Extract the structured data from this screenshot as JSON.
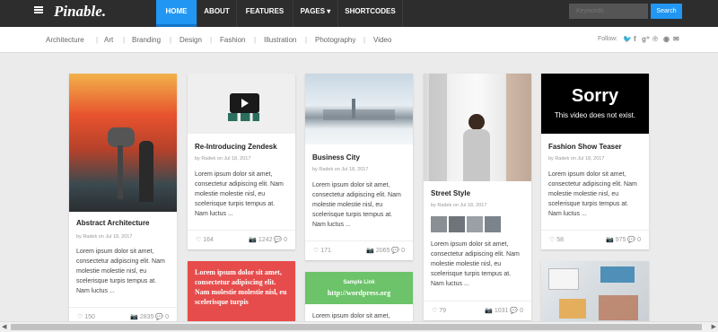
{
  "header": {
    "logo": "Pinable.",
    "nav": [
      {
        "label": "HOME"
      },
      {
        "label": "ABOUT"
      },
      {
        "label": "FEATURES"
      },
      {
        "label": "PAGES ▾"
      },
      {
        "label": "SHORTCODES"
      }
    ],
    "search_placeholder": "Keywords",
    "search_label": "Search"
  },
  "subnav": {
    "categories": [
      "Architecture",
      "Art",
      "Branding",
      "Design",
      "Fashion",
      "Illustration",
      "Photography",
      "Video"
    ],
    "follow_label": "Follow:",
    "social": [
      "twitter-icon",
      "facebook-icon",
      "google-plus-icon",
      "pinterest-icon",
      "rss-icon",
      "email-icon"
    ]
  },
  "cards": [
    {
      "title": "Abstract Architecture",
      "author": "by Radek on Jul 18, 2017",
      "excerpt": "Lorem ipsum dolor sit amet, consectetur adipiscing elit. Nam molestie molestie nisl, eu scelerisque turpis tempus at. Nam luctus ...",
      "likes": "150",
      "views": "2835",
      "comments": "0"
    },
    {
      "title": "Re-Introducing Zendesk",
      "author": "by Radek on Jul 18, 2017",
      "excerpt": "Lorem ipsum dolor sit amet, consectetur adipiscing elit. Nam molestie molestie nisl, eu scelerisque turpis tempus at. Nam luctus ...",
      "likes": "164",
      "views": "1242",
      "comments": "0"
    },
    {
      "quote": "Lorem ipsum dolor sit amet, consectetur adipiscing elit. Nam molestie molestie nisl, eu scelerisque turpis"
    },
    {
      "title": "Business City",
      "author": "by Radek on Jul 18, 2017",
      "excerpt": "Lorem ipsum dolor sit amet, consectetur adipiscing elit. Nam molestie molestie nisl, eu scelerisque turpis tempus at. Nam luctus ...",
      "likes": "171",
      "views": "2065",
      "comments": "0"
    },
    {
      "link_label": "Sample Link",
      "link_url": "http://wordpress.org",
      "excerpt": "Lorem ipsum dolor sit amet,"
    },
    {
      "title": "Street Style",
      "author": "by Radek on Jul 18, 2017",
      "excerpt": "Lorem ipsum dolor sit amet, consectetur adipiscing elit. Nam molestie molestie nisl, eu scelerisque turpis tempus at. Nam luctus ...",
      "likes": "79",
      "views": "1031",
      "comments": "0"
    },
    {
      "video_error": "Sorry",
      "video_sub": "This video does not exist.",
      "title": "Fashion Show Teaser",
      "author": "by Radek on Jul 18, 2017",
      "excerpt": "Lorem ipsum dolor sit amet, consectetur adipiscing elit. Nam molestie molestie nisl, eu scelerisque turpis tempus at. Nam luctus ...",
      "likes": "58",
      "views": "975",
      "comments": "0"
    }
  ]
}
